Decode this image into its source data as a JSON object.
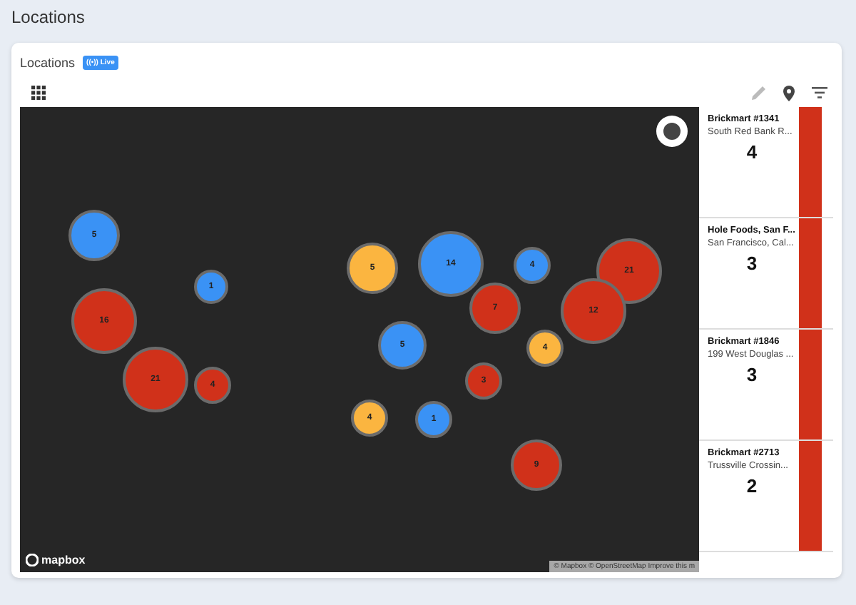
{
  "page_title": "Locations",
  "panel": {
    "title": "Locations",
    "live_badge": {
      "icon": "((•))",
      "label": "Live"
    }
  },
  "map": {
    "clusters": [
      {
        "count": "5",
        "color": "#3a92f5"
      },
      {
        "count": "1",
        "color": "#3a92f5"
      },
      {
        "count": "16",
        "color": "#d0311a"
      },
      {
        "count": "21",
        "color": "#d0311a"
      },
      {
        "count": "4",
        "color": "#d0311a"
      },
      {
        "count": "5",
        "color": "#fbb540"
      },
      {
        "count": "14",
        "color": "#3a92f5"
      },
      {
        "count": "4",
        "color": "#3a92f5"
      },
      {
        "count": "21",
        "color": "#d0311a"
      },
      {
        "count": "7",
        "color": "#d0311a"
      },
      {
        "count": "12",
        "color": "#d0311a"
      },
      {
        "count": "5",
        "color": "#3a92f5"
      },
      {
        "count": "4",
        "color": "#fbb540"
      },
      {
        "count": "3",
        "color": "#d0311a"
      },
      {
        "count": "4",
        "color": "#fbb540"
      },
      {
        "count": "1",
        "color": "#3a92f5"
      },
      {
        "count": "9",
        "color": "#d0311a"
      }
    ],
    "logo": "mapbox",
    "attribution": "© Mapbox © OpenStreetMap Improve this m"
  },
  "locations": [
    {
      "name": "Brickmart #1341",
      "address": "South Red Bank R...",
      "count": "4",
      "color": "#d0311a"
    },
    {
      "name": "Hole Foods, San F...",
      "address": "San Francisco, Cal...",
      "count": "3",
      "color": "#d0311a"
    },
    {
      "name": "Brickmart #1846",
      "address": "199 West Douglas ...",
      "count": "3",
      "color": "#d0311a"
    },
    {
      "name": "Brickmart #2713",
      "address": "Trussville Crossin...",
      "count": "2",
      "color": "#d0311a"
    }
  ]
}
